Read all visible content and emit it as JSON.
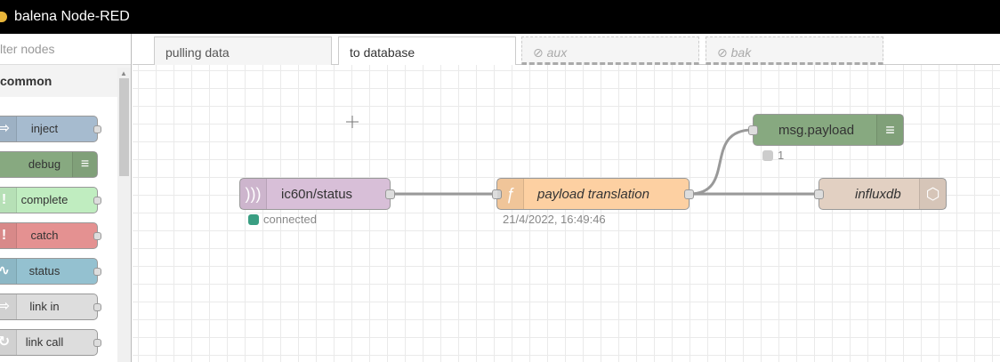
{
  "app": {
    "title": "balena Node-RED"
  },
  "palette": {
    "filter_placeholder": "lter nodes",
    "category": "common",
    "nodes": [
      {
        "label": "inject",
        "color": "#a6bbcf"
      },
      {
        "label": "debug",
        "color": "#87a980"
      },
      {
        "label": "complete",
        "color": "#c0edc0"
      },
      {
        "label": "catch",
        "color": "#e49191"
      },
      {
        "label": "status",
        "color": "#94c1d0"
      },
      {
        "label": "link in",
        "color": "#dddddd"
      },
      {
        "label": "link call",
        "color": "#dddddd"
      }
    ]
  },
  "tabs": [
    {
      "label": "pulling data",
      "state": "normal"
    },
    {
      "label": "to database",
      "state": "active"
    },
    {
      "label": "⊘ aux",
      "state": "disabled"
    },
    {
      "label": "⊘ bak",
      "state": "disabled"
    }
  ],
  "flow": {
    "nodes": {
      "mqtt": {
        "label": "ic60n/status",
        "color": "#d8bfd8",
        "status": "connected",
        "status_color": "#3a9e82"
      },
      "function": {
        "label": "payload translation",
        "color": "#fdd0a2",
        "status": "21/4/2022, 16:49:46"
      },
      "debug": {
        "label": "msg.payload",
        "color": "#87a980",
        "status": "1",
        "status_color": "#cccccc"
      },
      "influx": {
        "label": "influxdb",
        "color": "#e2d0c2"
      }
    }
  },
  "colors": {
    "topbar": "#000000",
    "wire": "#999999"
  }
}
